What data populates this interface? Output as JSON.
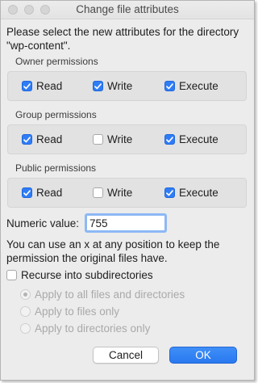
{
  "window": {
    "title": "Change file attributes"
  },
  "intro": "Please select the new attributes for the directory \"wp-content\".",
  "groups": [
    {
      "label": "Owner permissions",
      "options": [
        {
          "label": "Read",
          "checked": true
        },
        {
          "label": "Write",
          "checked": true
        },
        {
          "label": "Execute",
          "checked": true
        }
      ]
    },
    {
      "label": "Group permissions",
      "options": [
        {
          "label": "Read",
          "checked": true
        },
        {
          "label": "Write",
          "checked": false
        },
        {
          "label": "Execute",
          "checked": true
        }
      ]
    },
    {
      "label": "Public permissions",
      "options": [
        {
          "label": "Read",
          "checked": true
        },
        {
          "label": "Write",
          "checked": false
        },
        {
          "label": "Execute",
          "checked": true
        }
      ]
    }
  ],
  "numeric": {
    "label": "Numeric value:",
    "value": "755"
  },
  "hint": "You can use an x at any position to keep the permission the original files have.",
  "recurse": {
    "label": "Recurse into subdirectories",
    "checked": false
  },
  "apply_options": [
    {
      "label": "Apply to all files and directories",
      "selected": true,
      "enabled": false
    },
    {
      "label": "Apply to files only",
      "selected": false,
      "enabled": false
    },
    {
      "label": "Apply to directories only",
      "selected": false,
      "enabled": false
    }
  ],
  "buttons": {
    "cancel": "Cancel",
    "ok": "OK"
  },
  "colors": {
    "accent": "#2f7cf6",
    "focus_ring": "#8db8f5",
    "window_bg": "#ececec"
  }
}
